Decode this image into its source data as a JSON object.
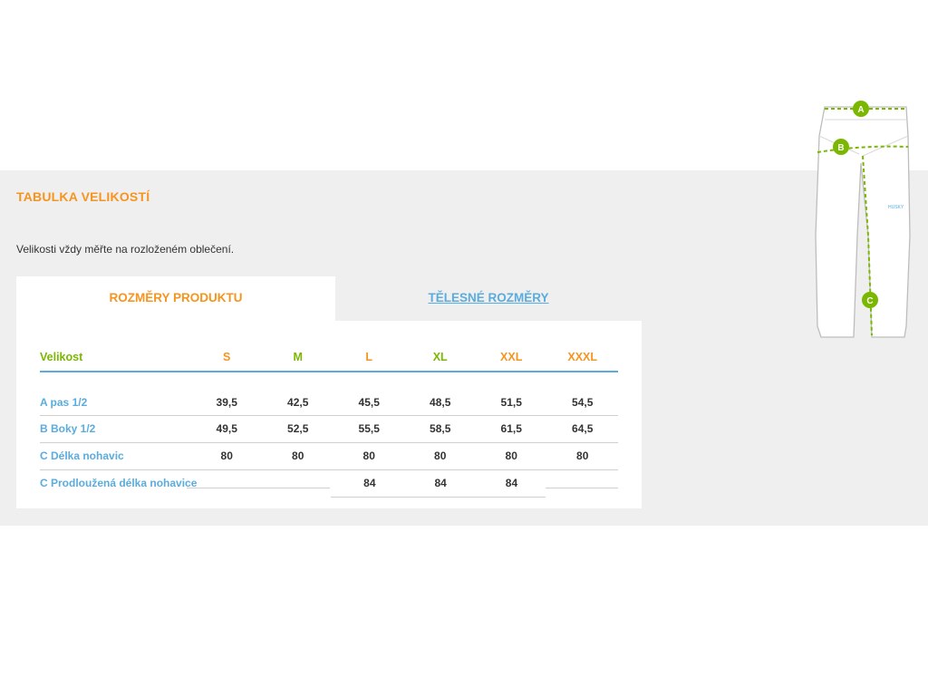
{
  "section": {
    "title": "TABULKA VELIKOSTÍ",
    "intro": "Velikosti vždy měřte na rozloženém oblečení."
  },
  "tabs": [
    {
      "label": "ROZMĚRY PRODUKTU",
      "active": true
    },
    {
      "label": "TĚLESNÉ ROZMĚRY",
      "active": false
    }
  ],
  "table": {
    "headers": [
      "Velikost",
      "S",
      "M",
      "L",
      "XL",
      "XXL",
      "XXXL"
    ],
    "rows": [
      {
        "label": "A pas 1/2",
        "values": [
          "39,5",
          "42,5",
          "45,5",
          "48,5",
          "51,5",
          "54,5"
        ]
      },
      {
        "label": "B Boky 1/2",
        "values": [
          "49,5",
          "52,5",
          "55,5",
          "58,5",
          "61,5",
          "64,5"
        ]
      },
      {
        "label": "C Délka nohavic",
        "values": [
          "80",
          "80",
          "80",
          "80",
          "80",
          "80"
        ]
      },
      {
        "label": "C Prodloužená délka nohavice",
        "values": [
          "",
          "",
          "84",
          "84",
          "84",
          ""
        ]
      }
    ]
  },
  "diagram": {
    "markers": [
      "A",
      "B",
      "C"
    ],
    "brand_text": "HUSKY"
  },
  "colors": {
    "orange": "#f7941d",
    "green": "#7ab800",
    "blue": "#5aacde",
    "panel": "#efefef"
  },
  "icons": {
    "collapse": "minus-icon"
  }
}
